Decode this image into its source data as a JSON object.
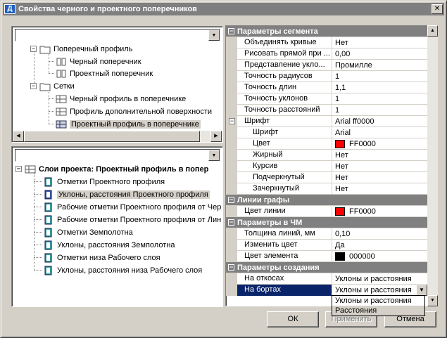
{
  "window": {
    "title": "Свойства черного и проектного поперечников",
    "app_icon": "Д",
    "close_glyph": "✕"
  },
  "top_tree": {
    "filter_value": "",
    "items": [
      {
        "label": "Поперечный профиль",
        "icon": "folder-icon",
        "toggle": "−"
      },
      {
        "label": "Черный поперечник",
        "icon": "book-icon"
      },
      {
        "label": "Проектный поперечник",
        "icon": "book-icon"
      },
      {
        "label": "Сетки",
        "icon": "folder-icon",
        "toggle": "−"
      },
      {
        "label": "Черный профиль в поперечнике",
        "icon": "grid-icon"
      },
      {
        "label": "Профиль дополнительной поверхности",
        "icon": "grid-icon"
      },
      {
        "label": "Проектный профиль в поперечнике",
        "icon": "grid-icon",
        "selected": true
      }
    ]
  },
  "bottom_tree": {
    "filter_value": "",
    "root": {
      "label": "Слои проекта: Проектный профиль в попер",
      "toggle": "−",
      "icon": "grid-icon"
    },
    "items": [
      {
        "label": "Отметки Проектного профиля",
        "icon": "layer-icon"
      },
      {
        "label": "Уклоны, расстояния Проектного профиля",
        "icon": "layer-icon",
        "selected": true
      },
      {
        "label": "Рабочие отметки Проектного профиля от Чер",
        "icon": "layer-icon"
      },
      {
        "label": "Рабочие отметки Проектного профиля от Лин",
        "icon": "layer-icon"
      },
      {
        "label": "Отметки Земполотна",
        "icon": "layer-icon"
      },
      {
        "label": "Уклоны, расстояния Земполотна",
        "icon": "layer-icon"
      },
      {
        "label": "Отметки низа Рабочего слоя",
        "icon": "layer-icon"
      },
      {
        "label": "Уклоны, расстояния низа Рабочего слоя",
        "icon": "layer-icon"
      }
    ]
  },
  "properties": {
    "segment_params": "Параметры сегмента",
    "rows": [
      {
        "name": "Объединять кривые",
        "value": "Нет"
      },
      {
        "name": "Рисовать прямой при ...",
        "value": "0,00"
      },
      {
        "name": "Представление укло...",
        "value": "Промилле"
      },
      {
        "name": "Точность радиусов",
        "value": "1"
      },
      {
        "name": "Точность длин",
        "value": "1,1"
      },
      {
        "name": "Точность уклонов",
        "value": "1"
      },
      {
        "name": "Точность расстояний",
        "value": "1"
      }
    ],
    "font": {
      "name": "Шрифт",
      "value": "Arial ff0000",
      "toggle": "−"
    },
    "font_rows": [
      {
        "name": "Шрифт",
        "value": "Arial"
      },
      {
        "name": "Цвет",
        "value": "FF0000",
        "swatch": "#ff0000"
      },
      {
        "name": "Жирный",
        "value": "Нет"
      },
      {
        "name": "Курсив",
        "value": "Нет"
      },
      {
        "name": "Подчеркнутый",
        "value": "Нет"
      },
      {
        "name": "Зачеркнутый",
        "value": "Нет"
      }
    ],
    "grid_lines": "Линии графы",
    "line_color": {
      "name": "Цвет линии",
      "value": "FF0000",
      "swatch": "#ff0000"
    },
    "cm_params": "Параметры в ЧМ",
    "cm_rows": [
      {
        "name": "Толщина линий, мм",
        "value": "0,10"
      },
      {
        "name": "Изменить цвет",
        "value": "Да"
      },
      {
        "name": "Цвет элемента",
        "value": "000000",
        "swatch": "#000000"
      }
    ],
    "creation_params": "Параметры создания",
    "creation_rows": [
      {
        "name": "На откосах",
        "value": "Уклоны и расстояния"
      },
      {
        "name": "На бортах",
        "value": "Уклоны и расстояния",
        "editing": true
      }
    ],
    "dropdown_options": [
      "Уклоны и расстояния",
      "Расстояния"
    ],
    "dropdown_arrow": "▼"
  },
  "buttons": {
    "ok": "ОК",
    "apply": "Применить",
    "cancel": "Отмена"
  },
  "colors": {
    "selection": "#0a246a",
    "category": "#808080",
    "face": "#d4d0c8"
  }
}
